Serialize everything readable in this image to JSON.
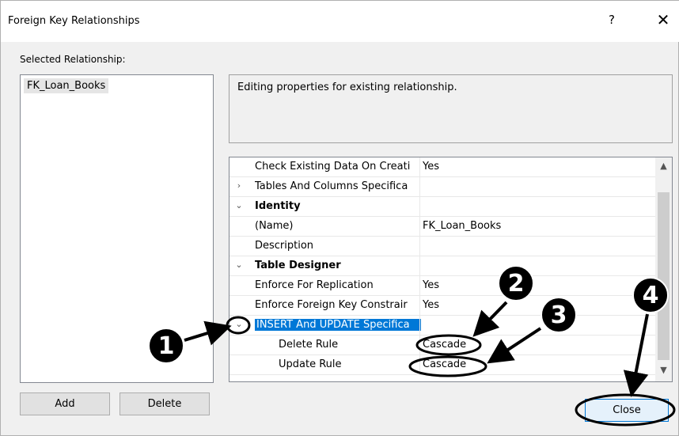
{
  "window": {
    "title": "Foreign Key Relationships",
    "help_label": "?",
    "close_label": "✕"
  },
  "left_panel": {
    "label": "Selected Relationship:",
    "items": [
      "FK_Loan_Books"
    ],
    "add_label": "Add",
    "delete_label": "Delete"
  },
  "description": "Editing properties for existing relationship.",
  "properties": [
    {
      "toggle": "",
      "name": "Check Existing Data On Creati",
      "value": "Yes",
      "kind": "prop"
    },
    {
      "toggle": "›",
      "name": "Tables And Columns Specifica",
      "value": "",
      "kind": "prop"
    },
    {
      "toggle": "⌄",
      "name": "Identity",
      "value": "",
      "kind": "cat"
    },
    {
      "toggle": "",
      "name": "(Name)",
      "value": "FK_Loan_Books",
      "kind": "prop"
    },
    {
      "toggle": "",
      "name": "Description",
      "value": "",
      "kind": "prop"
    },
    {
      "toggle": "⌄",
      "name": "Table Designer",
      "value": "",
      "kind": "cat"
    },
    {
      "toggle": "",
      "name": "Enforce For Replication",
      "value": "Yes",
      "kind": "prop"
    },
    {
      "toggle": "",
      "name": "Enforce Foreign Key Constrair",
      "value": "Yes",
      "kind": "prop"
    },
    {
      "toggle": "⌄",
      "name": "INSERT And UPDATE Specifica",
      "value": "",
      "kind": "selected"
    },
    {
      "toggle": "",
      "name": "Delete Rule",
      "value": "Cascade",
      "kind": "sub"
    },
    {
      "toggle": "",
      "name": "Update Rule",
      "value": "Cascade",
      "kind": "sub"
    }
  ],
  "close_button_label": "Close",
  "markers": [
    "1",
    "2",
    "3",
    "4"
  ],
  "colors": {
    "selection": "#0078d7",
    "marker": "#000000"
  }
}
